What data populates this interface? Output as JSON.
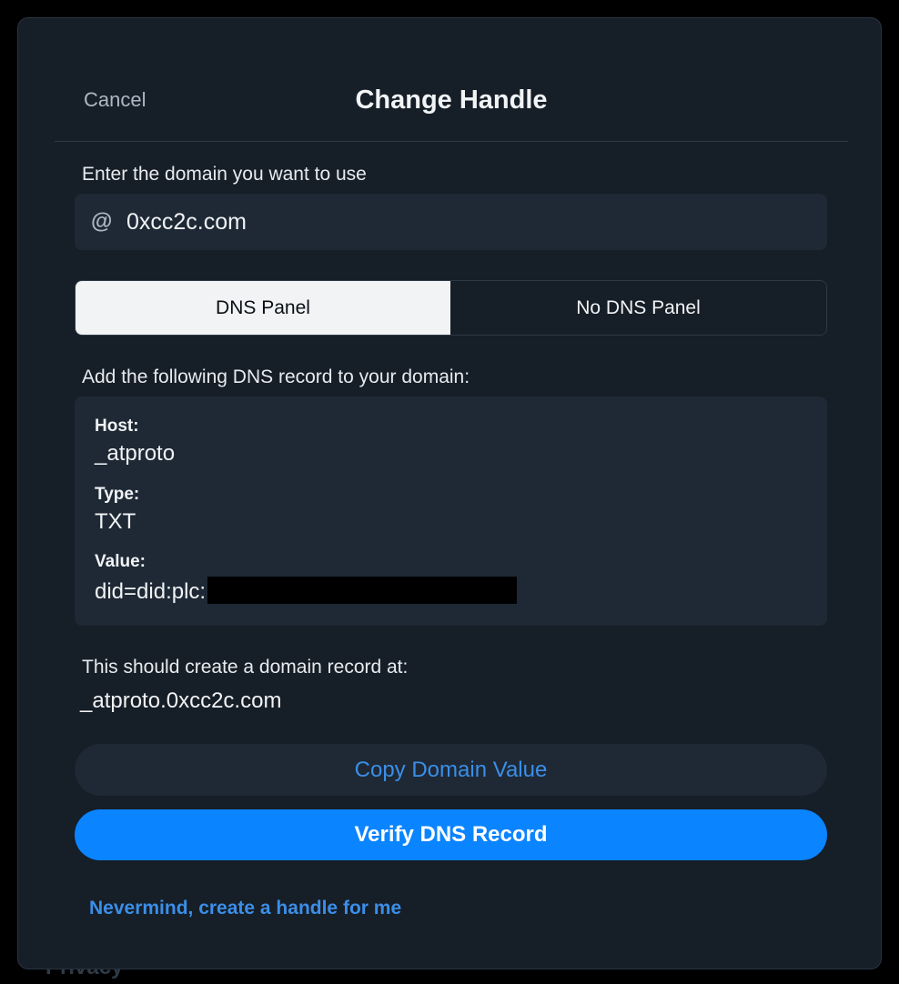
{
  "backdrop": {
    "partial_text": "Privacy"
  },
  "modal": {
    "cancel_label": "Cancel",
    "title": "Change Handle",
    "domain_prompt": "Enter the domain you want to use",
    "domain_input": {
      "prefix": "@",
      "value": "0xcc2c.com"
    },
    "tabs": [
      {
        "label": "DNS Panel",
        "selected": true
      },
      {
        "label": "No DNS Panel",
        "selected": false
      }
    ],
    "dns_instruction": "Add the following DNS record to your domain:",
    "record": {
      "host_label": "Host:",
      "host_value": "_atproto",
      "type_label": "Type:",
      "type_value": "TXT",
      "value_label": "Value:",
      "value_prefix": "did=did:plc:"
    },
    "record_location_label": "This should create a domain record at:",
    "record_location_value": "_atproto.0xcc2c.com",
    "copy_button": "Copy Domain Value",
    "verify_button": "Verify DNS Record",
    "nevermind_link": "Nevermind, create a handle for me"
  },
  "colors": {
    "background": "#000000",
    "modal": "#161e27",
    "field": "#1e2935",
    "accent": "#0a84ff",
    "link": "#3b8ee8"
  }
}
